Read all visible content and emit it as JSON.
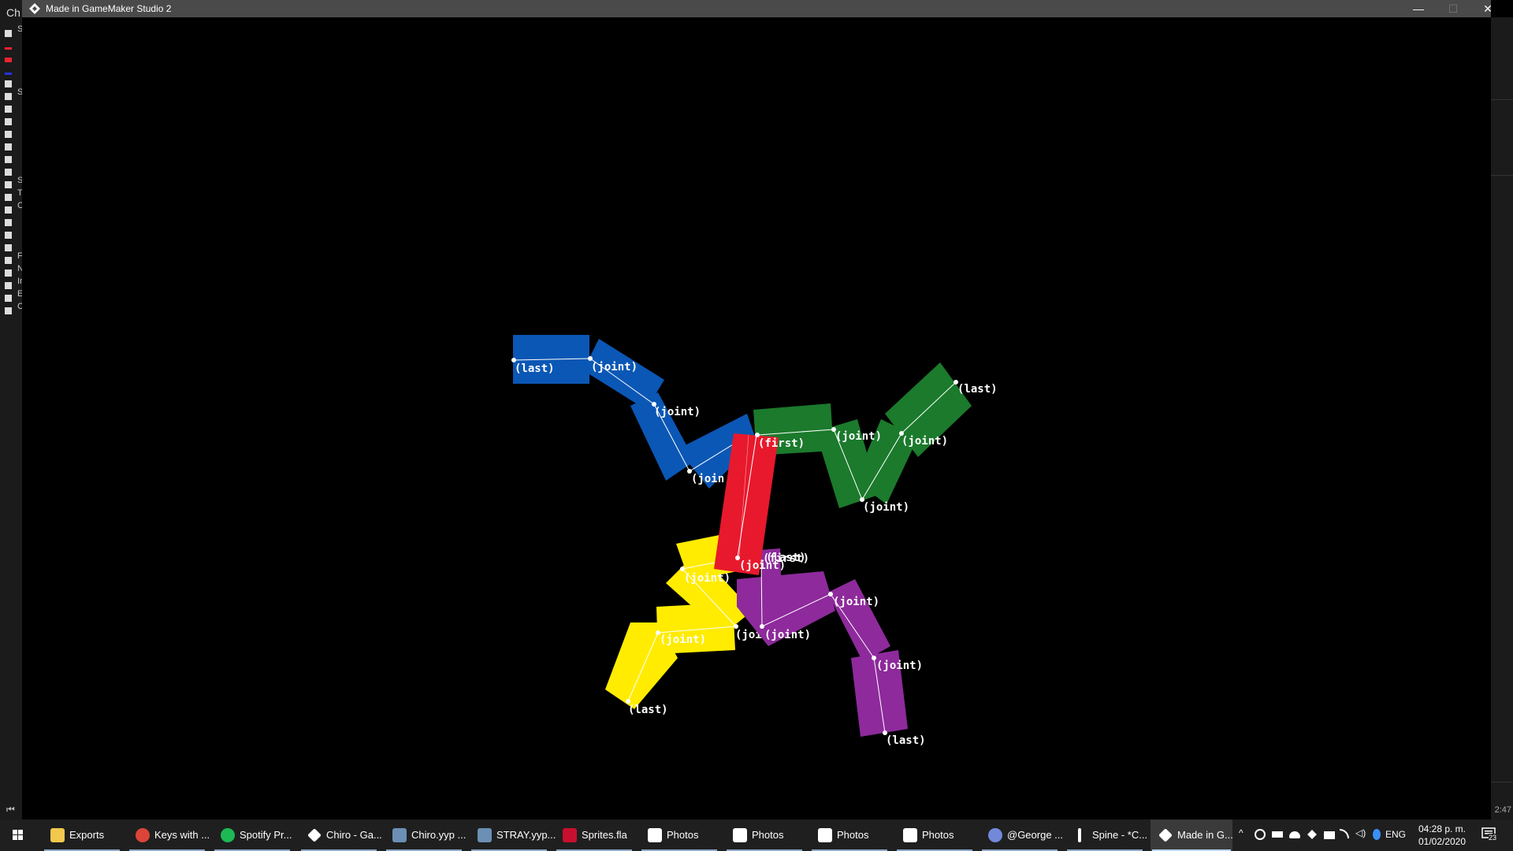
{
  "window": {
    "title": "Made in GameMaker Studio 2",
    "minimize": "—",
    "maximize": "☐",
    "close": "✕"
  },
  "background_app": {
    "title_fragment": "Ch",
    "tree_fragments": [
      "S",
      "S",
      "S",
      "T",
      "C",
      "F",
      "N",
      "In",
      "E",
      "C"
    ],
    "time_fragment": "2:47"
  },
  "colors": {
    "blue": "#0b57b5",
    "green": "#1b7a2c",
    "red": "#e8192c",
    "yellow": "#ffec00",
    "purple": "#8e2a9c",
    "titlebar": "#4a4a4a",
    "taskbar": "#1f1f1f"
  },
  "labels": {
    "blue_last": "(last)",
    "blue_joint1": "(joint)",
    "blue_joint2": "(joint)",
    "blue_joint3": "(join",
    "red_first": "(first)",
    "green_joint1": "(joint)",
    "green_joint2": "(joint)",
    "green_joint3": "(joint)",
    "green_last": "(last)",
    "center_first": "(first)",
    "center_last": "(last)",
    "yellow_joint_top": "(joint)",
    "yellow_joint_mid": "(joint)",
    "yellow_joint_low": "(joint)",
    "yellow_last": "(last)",
    "purple_joint1": "(joint)",
    "purple_joint2": "(joint)",
    "purple_joint3": "(joint)",
    "purple_last": "(last)"
  },
  "taskbar": {
    "items": [
      {
        "label": "Exports",
        "icon": "folder-icon",
        "color": "#f2c94c"
      },
      {
        "label": "Keys with ...",
        "icon": "chrome-icon",
        "color": "#db4437"
      },
      {
        "label": "Spotify Pr...",
        "icon": "spotify-icon",
        "color": "#1db954"
      },
      {
        "label": "Chiro - Ga...",
        "icon": "gamemaker-icon",
        "color": "#ffffff"
      },
      {
        "label": "Chiro.yyp ...",
        "icon": "gamemaker-project-icon",
        "color": "#6b8fb5"
      },
      {
        "label": "STRAY.yyp...",
        "icon": "gamemaker-project-icon",
        "color": "#6b8fb5"
      },
      {
        "label": "Sprites.fla",
        "icon": "flash-icon",
        "color": "#c8102e"
      },
      {
        "label": "Photos",
        "icon": "photos-icon",
        "color": "#ffffff"
      },
      {
        "label": "Photos",
        "icon": "photos-icon",
        "color": "#ffffff"
      },
      {
        "label": "Photos",
        "icon": "photos-icon",
        "color": "#ffffff"
      },
      {
        "label": "Photos",
        "icon": "photos-icon",
        "color": "#ffffff"
      },
      {
        "label": "@George ...",
        "icon": "discord-icon",
        "color": "#7289da"
      },
      {
        "label": "Spine - *C...",
        "icon": "spine-icon",
        "color": "#ffffff"
      },
      {
        "label": "Made in G...",
        "icon": "gamemaker-icon",
        "color": "#ffffff"
      }
    ],
    "language": "ENG",
    "time": "04:28 p. m.",
    "date": "01/02/2020",
    "notifications": "23"
  }
}
